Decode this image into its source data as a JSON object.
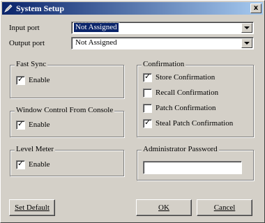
{
  "window": {
    "title": "System Setup",
    "close_glyph": "x"
  },
  "ports": {
    "input_label": "Input port",
    "input_value": "Not Assigned",
    "output_label": "Output port",
    "output_value": "Not Assigned"
  },
  "fast_sync": {
    "title": "Fast Sync",
    "enable_label": "Enable",
    "checked": true
  },
  "window_control": {
    "title": "Window Control From Console",
    "enable_label": "Enable",
    "checked": true
  },
  "level_meter": {
    "title": "Level Meter",
    "enable_label": "Enable",
    "checked": true
  },
  "confirmation": {
    "title": "Confirmation",
    "items": [
      {
        "label": "Store Confirmation",
        "checked": true
      },
      {
        "label": "Recall Confirmation",
        "checked": false
      },
      {
        "label": "Patch Confirmation",
        "checked": false
      },
      {
        "label": "Steal Patch Confirmation",
        "checked": true
      }
    ]
  },
  "admin_password": {
    "title": "Administrator Password",
    "value": ""
  },
  "buttons": {
    "set_default": "Set Default",
    "ok": "OK",
    "cancel": "Cancel"
  },
  "check_glyph": "✓",
  "icons": {
    "title": "pencil-icon",
    "close": "close-icon",
    "dropdown": "chevron-down-icon"
  }
}
